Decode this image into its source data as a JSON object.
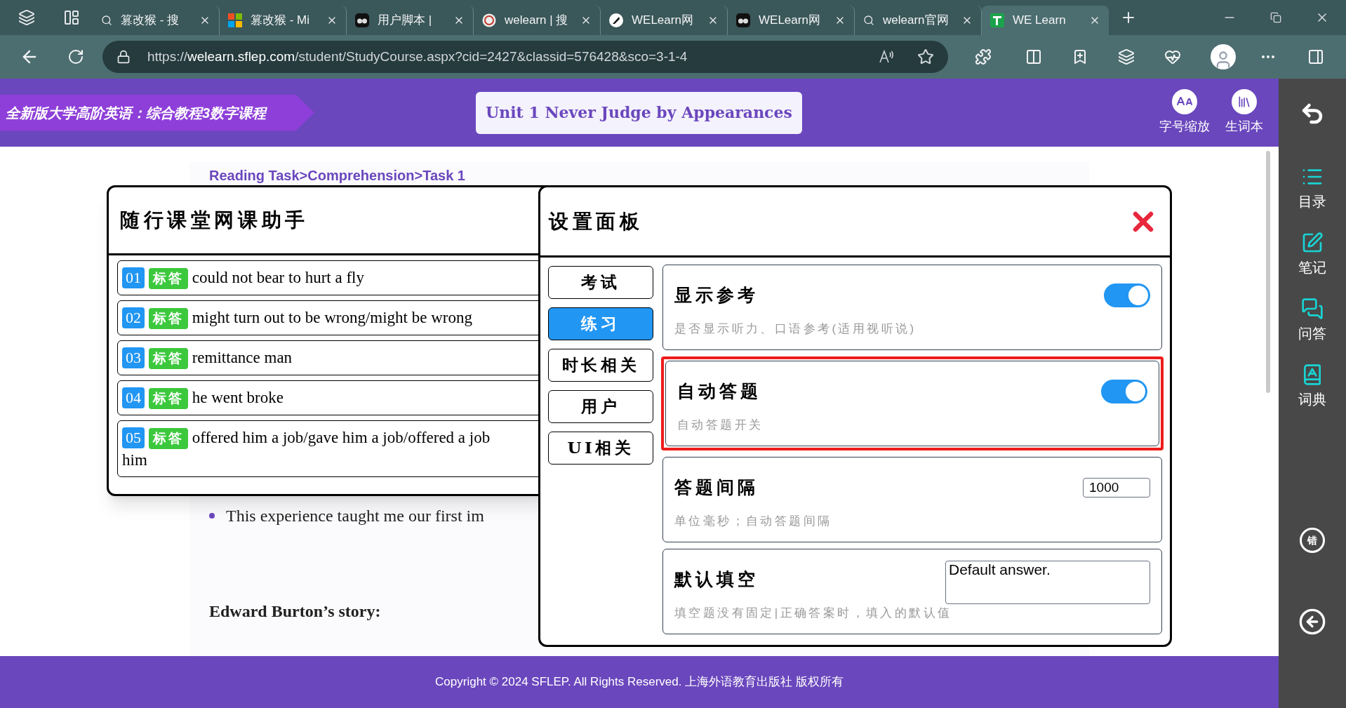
{
  "browser": {
    "tabs": [
      {
        "label": "篡改猴 - 搜",
        "kind": "search",
        "selected": false
      },
      {
        "label": "篡改猴 - Mi",
        "kind": "windows",
        "selected": false
      },
      {
        "label": "用户脚本 |",
        "kind": "script",
        "selected": false
      },
      {
        "label": "welearn | 搜",
        "kind": "circle",
        "selected": false
      },
      {
        "label": "WELearn网",
        "kind": "feather",
        "selected": false
      },
      {
        "label": "WELearn网",
        "kind": "script",
        "selected": false
      },
      {
        "label": "welearn官网",
        "kind": "search",
        "selected": false
      },
      {
        "label": "WE Learn",
        "kind": "course",
        "selected": true
      }
    ],
    "url": "https://**welearn.sflep.com**/student/StudyCourse.aspx?cid=2427&classid=576428&sco=3-1-4"
  },
  "header": {
    "course": "全新版大学高阶英语：综合教程3数字课程",
    "unit_title": "Unit 1 Never Judge by Appearances",
    "tools": [
      {
        "label": "字号缩放",
        "kind": "font-size"
      },
      {
        "label": "生词本",
        "kind": "book"
      }
    ]
  },
  "sidebar": {
    "items": [
      {
        "kind": "back"
      },
      {
        "kind": "list",
        "label": "目录"
      },
      {
        "kind": "note",
        "label": "笔记"
      },
      {
        "kind": "chat",
        "label": "问答"
      },
      {
        "kind": "dictionary",
        "label": "词典"
      },
      {
        "kind": "glyph",
        "glyph": "错"
      },
      {
        "kind": "back-circle"
      }
    ]
  },
  "content": {
    "breadcrumb": "Reading Task>Comprehension>Task 1",
    "bullet": "This experience taught me our first im",
    "story_heading": "Edward Burton’s story:"
  },
  "helper": {
    "title": "随行课堂网课助手",
    "answers": [
      {
        "number": "01",
        "tag": "标答",
        "text": "could not bear to hurt a fly"
      },
      {
        "number": "02",
        "tag": "标答",
        "text": "might turn out to be wrong/might be wrong"
      },
      {
        "number": "03",
        "tag": "标答",
        "text": "remittance man"
      },
      {
        "number": "04",
        "tag": "标答",
        "text": "he went broke"
      },
      {
        "number": "05",
        "tag": "标答",
        "text": "offered him a job/gave him a job/offered a job\nhim"
      }
    ]
  },
  "settings": {
    "title": "设置面板",
    "nav": [
      {
        "label": "考试",
        "selected": false
      },
      {
        "label": "练习",
        "selected": true
      },
      {
        "label": "时长相关",
        "selected": false
      },
      {
        "label": "用户",
        "selected": false
      },
      {
        "label": "UI相关",
        "selected": false
      }
    ],
    "options": [
      {
        "kind": "toggle",
        "title": "显示参考",
        "description": "是否显示听力、口语参考(适用视听说)",
        "on": true,
        "highlighted": false
      },
      {
        "kind": "toggle",
        "title": "自动答题",
        "description": "自动答题开关",
        "on": true,
        "highlighted": true
      },
      {
        "kind": "number",
        "title": "答题间隔",
        "value": "1000",
        "description": "单位毫秒；自动答题间隔",
        "highlighted": false
      },
      {
        "kind": "textarea",
        "title": "默认填空",
        "value": "Default answer.",
        "description": "填空题没有固定|正确答案时，填入的默认值",
        "highlighted": false
      }
    ]
  },
  "footer": {
    "copyright": "Copyright © 2024 SFLEP. All Rights Reserved. 上海外语教育出版社 版权所有"
  }
}
